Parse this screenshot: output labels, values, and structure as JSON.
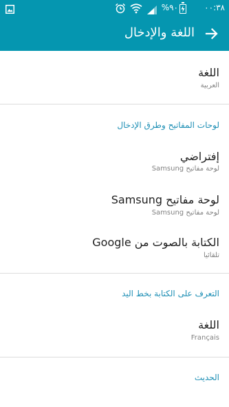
{
  "status_bar": {
    "time": "٠٠:٣٨",
    "battery_pct": "%٩٠",
    "icons": [
      "gallery-icon",
      "alarm-icon",
      "wifi-icon",
      "signal-icon",
      "battery-charging-icon"
    ]
  },
  "app_bar": {
    "title": "اللغة والإدخال",
    "back_icon": "arrow-right-icon"
  },
  "language_item": {
    "title": "اللغة",
    "subtitle": "العربية"
  },
  "keyboards_section": {
    "header": "لوحات المفاتيح وطرق الإدخال",
    "items": [
      {
        "title": "إفتراضي",
        "subtitle": "لوحة مفاتيح Samsung"
      },
      {
        "title": "لوحة مفاتيح Samsung",
        "subtitle": "لوحة مفاتيح Samsung"
      },
      {
        "title": "الكتابة بالصوت من Google",
        "subtitle": "تلقائيا"
      }
    ]
  },
  "handwriting_section": {
    "header": "التعرف على الكتابة بخط اليد",
    "items": [
      {
        "title": "اللغة",
        "subtitle": "Français"
      }
    ]
  },
  "speech_section": {
    "header": "الحديث"
  },
  "colors": {
    "primary": "#0596b0",
    "section_header": "#1e8fb5",
    "divider": "#dcdcdc"
  }
}
